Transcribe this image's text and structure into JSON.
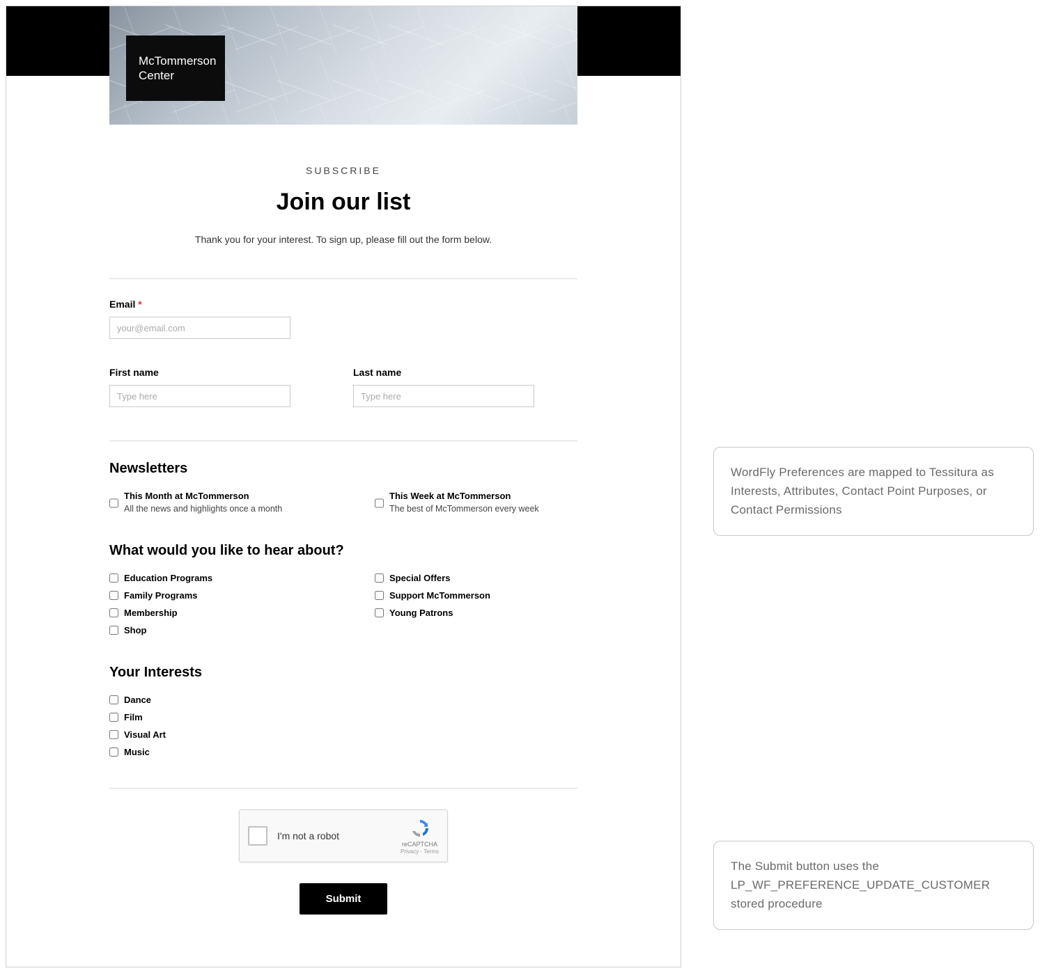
{
  "logo": {
    "line1": "McTommerson",
    "line2": "Center"
  },
  "header": {
    "eyebrow": "SUBSCRIBE",
    "title": "Join our list",
    "intro": "Thank you for your interest. To sign up, please fill out the form below."
  },
  "form": {
    "email": {
      "label": "Email",
      "required_marker": "*",
      "placeholder": "your@email.com"
    },
    "first_name": {
      "label": "First name",
      "placeholder": "Type here"
    },
    "last_name": {
      "label": "Last name",
      "placeholder": "Type here"
    }
  },
  "newsletters": {
    "heading": "Newsletters",
    "items": [
      {
        "title": "This Month at McTommerson",
        "desc": "All the news and highlights once a month"
      },
      {
        "title": "This Week at McTommerson",
        "desc": "The best of McTommerson every week"
      }
    ]
  },
  "topics": {
    "heading": "What would you like to hear about?",
    "items": [
      "Education Programs",
      "Special Offers",
      "Family Programs",
      "Support McTommerson",
      "Membership",
      "Young Patrons",
      "Shop"
    ]
  },
  "interests": {
    "heading": "Your Interests",
    "items": [
      "Dance",
      "Film",
      "Visual Art",
      "Music"
    ]
  },
  "captcha": {
    "label": "I'm not a robot",
    "brand": "reCAPTCHA",
    "links": "Privacy - Terms"
  },
  "submit_label": "Submit",
  "callouts": {
    "one": "WordFly Preferences are mapped to Tessitura as Interests, Attributes, Contact Point Purposes, or Contact Permissions",
    "two": "The Submit button uses the LP_WF_PREFERENCE_UPDATE_CUSTOMER stored procedure"
  }
}
